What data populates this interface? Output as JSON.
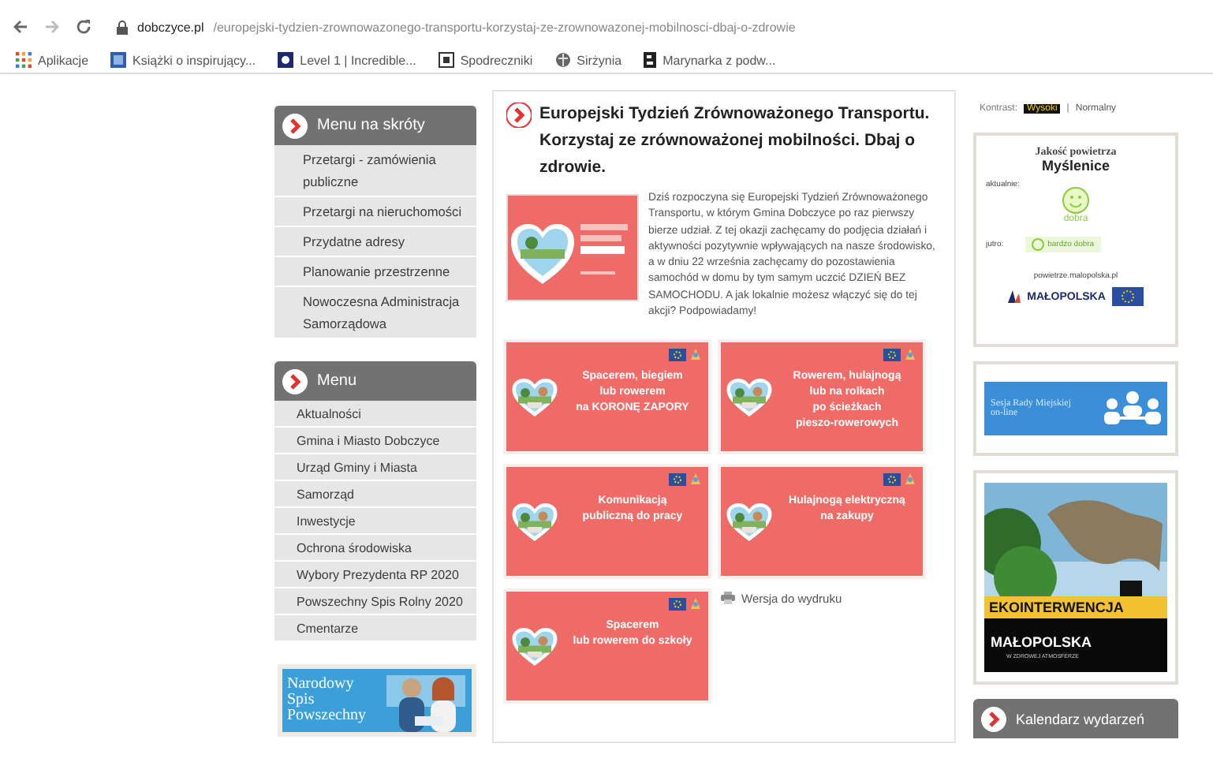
{
  "browser": {
    "domain": "dobczyce.pl",
    "path": "/europejski-tydzien-zrownowazonego-transportu-korzystaj-ze-zrownowazonej-mobilnosci-dbaj-o-zdrowie",
    "bookmarks": [
      {
        "label": "Aplikacje",
        "kind": "apps"
      },
      {
        "label": "Książki o inspirujący...",
        "kind": "book"
      },
      {
        "label": "Level 1 | Incredible...",
        "kind": "level"
      },
      {
        "label": "Spodreczniki",
        "kind": "page"
      },
      {
        "label": "Sirżynia",
        "kind": "globe"
      },
      {
        "label": "Marynarka z podw...",
        "kind": "letter"
      }
    ]
  },
  "sidebar": {
    "shortcuts": {
      "title": "Menu na skróty",
      "items": [
        "Przetargi - zamówienia publiczne",
        "Przetargi na nieruchomości",
        "Przydatne adresy",
        "Planowanie przestrzenne",
        "Nowoczesna Administracja Samorządowa"
      ]
    },
    "menu": {
      "title": "Menu",
      "items": [
        "Aktualności",
        "Gmina i Miasto Dobczyce",
        "Urząd Gminy i Miasta",
        "Samorząd",
        "Inwestycje",
        "Ochrona środowiska",
        "Wybory Prezydenta RP 2020",
        "Powszechny Spis Rolny 2020",
        "Cmentarze"
      ]
    },
    "banner": {
      "text": "Narodowy Spis Powszechny"
    }
  },
  "article": {
    "title": "Europejski Tydzień Zrównoważonego Transportu. Korzystaj ze zrównoważonej mobilności. Dbaj o zdrowie.",
    "body": "Dziś rozpoczyna się Europejski Tydzień Zrównoważonego Transportu, w którym Gmina Dobczyce po raz pierwszy bierze udział. Z tej okazji zachęcamy do podjęcia działań i aktywności pozytywnie wpływających na nasze środowisko, a w dniu 22 września zachęcamy do pozostawienia samochód w domu by tym samym uczcić DZIEŃ BEZ SAMOCHODU. A jak lokalnie możesz włączyć się do tej akcji? Podpowiadamy!",
    "tiles": [
      {
        "text": "Spacerem, biegiem\nlub rowerem\nna KORONĘ ZAPORY"
      },
      {
        "text": "Rowerem, hulajnogą\nlub na rolkach\npo ścieżkach\npieszo-rowerowych"
      },
      {
        "text": "Komunikacją\npubliczną do pracy"
      },
      {
        "text": "Hulajnogą elektryczną\nna zakupy"
      },
      {
        "text": "Spacerem\nlub rowerem do szkoły"
      }
    ],
    "print_link": "Wersja do wydruku"
  },
  "right": {
    "contrast": {
      "label": "Kontrast:",
      "options": [
        {
          "label": "Wysoki",
          "selected": true
        },
        {
          "label": "Normalny",
          "selected": false
        }
      ],
      "separator": "|"
    },
    "air": {
      "title": "Jakość powietrza",
      "city": "Myślenice",
      "now_label": "aktualnie:",
      "now_value": "dobra",
      "tomorrow_label": "jutro:",
      "tomorrow_value": "bardzo dobra",
      "source": "powietrze.malopolska.pl",
      "brand": "MAŁOPOLSKA"
    },
    "session_banner": {
      "text": "Sesja Rady Miejskiej on-line"
    },
    "eco_banner": {
      "title": "EKOINTERWENCJA",
      "brand": "MAŁOPOLSKA",
      "tagline": "W ZDROWEJ ATMOSFERZE"
    },
    "calendar": {
      "title": "Kalendarz wydarzeń"
    }
  }
}
